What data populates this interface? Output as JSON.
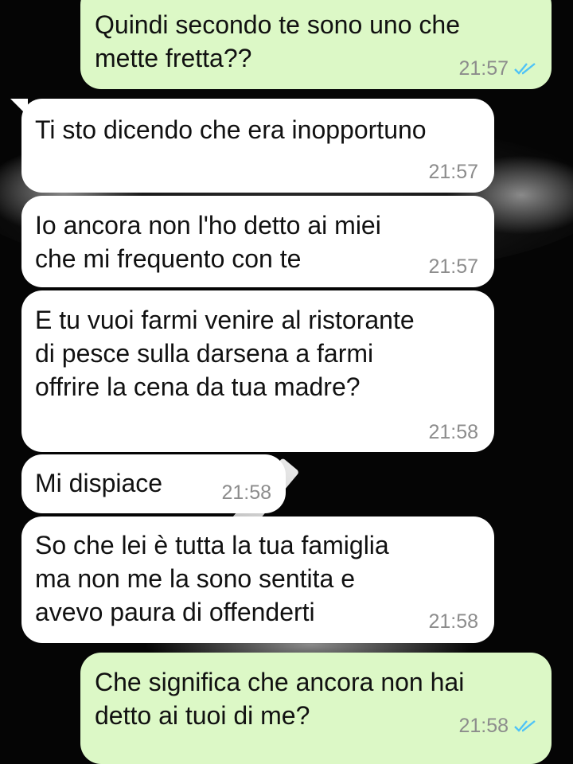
{
  "messages": [
    {
      "direction": "out",
      "text": "Quindi secondo te sono uno che\nmette fretta??",
      "time": "21:57",
      "status": "read-double-tick-icon"
    },
    {
      "direction": "in",
      "text": "Ti sto dicendo che era inopportuno",
      "time": "21:57"
    },
    {
      "direction": "in",
      "text": "Io ancora non l'ho detto ai miei\nche mi frequento con te",
      "time": "21:57"
    },
    {
      "direction": "in",
      "text": "E tu vuoi farmi venire al ristorante\ndi pesce sulla darsena a farmi\noffrire la cena da tua madre?",
      "time": "21:58"
    },
    {
      "direction": "in",
      "text": "Mi dispiace",
      "time": "21:58"
    },
    {
      "direction": "in",
      "text": "So che lei è tutta la tua famiglia\nma non me la sono sentita e\navevo paura di offenderti",
      "time": "21:58"
    },
    {
      "direction": "out",
      "text": "Che significa che ancora non hai\ndetto ai tuoi di me?",
      "time": "21:58",
      "status": "read-double-tick-icon"
    }
  ],
  "colors": {
    "incoming_bubble": "#ffffff",
    "outgoing_bubble": "#dcf8c6",
    "read_tick": "#4fc3f7",
    "timestamp": "#8c8c8c"
  }
}
